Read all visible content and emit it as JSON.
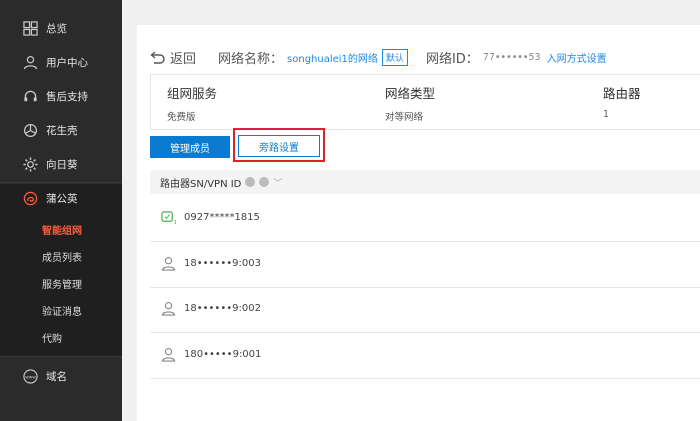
{
  "sidebar": {
    "items": [
      {
        "label": "总览",
        "icon": "grid-icon"
      },
      {
        "label": "用户中心",
        "icon": "user-icon"
      },
      {
        "label": "售后支持",
        "icon": "headset-icon"
      },
      {
        "label": "花生壳",
        "icon": "peanut-shell-icon"
      },
      {
        "label": "向日葵",
        "icon": "sunflower-icon"
      },
      {
        "label": "蒲公英",
        "icon": "dandelion-icon"
      }
    ],
    "subitems": [
      {
        "label": "智能组网",
        "active": true
      },
      {
        "label": "成员列表"
      },
      {
        "label": "服务管理"
      },
      {
        "label": "验证消息"
      },
      {
        "label": "代购"
      }
    ],
    "domain": {
      "label": "域名",
      "icon": "www-icon"
    }
  },
  "header": {
    "back_label": "返回",
    "network_name_label": "网络名称：",
    "network_name": "songhualei1的网络",
    "default_tag": "默认",
    "network_id_label": "网络ID：",
    "network_id": "77••••••53",
    "join_method_link": "入网方式设置"
  },
  "info": {
    "service_title": "组网服务",
    "service_value": "免费版",
    "type_title": "网络类型",
    "type_value": "对等网络",
    "router_title": "路由器",
    "router_value": "1"
  },
  "buttons": {
    "manage_members": "管理成员",
    "bypass_settings": "旁路设置"
  },
  "table": {
    "header": "路由器SN/VPN ID",
    "rows": [
      {
        "id": "0927*****1815",
        "type": "router"
      },
      {
        "id": "18••••••9:003",
        "type": "user"
      },
      {
        "id": "18••••••9:002",
        "type": "user"
      },
      {
        "id": "180•••••9:001",
        "type": "user"
      }
    ]
  },
  "colors": {
    "sidebar_bg": "#2b2b2b",
    "accent_blue": "#0b7bd1",
    "active_red": "#ff5a3c",
    "highlight_box": "#d9222a"
  }
}
